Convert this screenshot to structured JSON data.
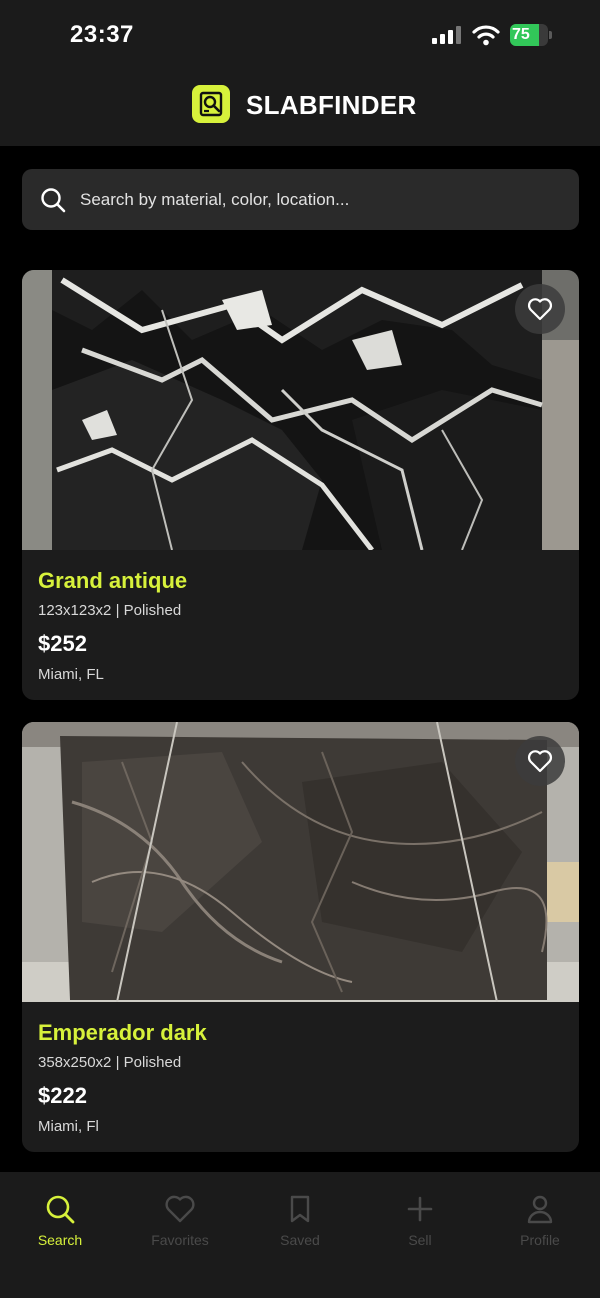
{
  "status": {
    "time": "23:37",
    "battery": "75",
    "battery_level": 0.75
  },
  "header": {
    "title": "SLABFINDER",
    "logo_icon": "magnifier-logo-icon"
  },
  "search": {
    "placeholder": "Search by material, color, location..."
  },
  "listings": [
    {
      "name": "Grand antique",
      "spec": "123x123x2 | Polished",
      "price": "$252",
      "location": "Miami, FL"
    },
    {
      "name": "Emperador dark",
      "spec": "358x250x2 | Polished",
      "price": "$222",
      "location": "Miami, Fl"
    }
  ],
  "tabs": [
    {
      "label": "Search",
      "icon": "search-icon",
      "active": true
    },
    {
      "label": "Favorites",
      "icon": "heart-icon",
      "active": false
    },
    {
      "label": "Saved",
      "icon": "bookmark-icon",
      "active": false
    },
    {
      "label": "Sell",
      "icon": "plus-icon",
      "active": false
    },
    {
      "label": "Profile",
      "icon": "profile-icon",
      "active": false
    }
  ],
  "colors": {
    "accent": "#d7f13b",
    "background": "#000000",
    "surface": "#1c1c1c"
  }
}
